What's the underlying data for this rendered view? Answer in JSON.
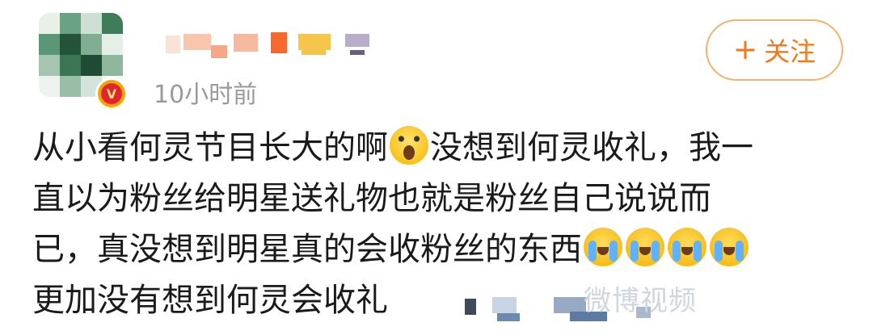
{
  "post": {
    "timestamp": "10小时前",
    "follow_label": "关注",
    "follow_plus": "+",
    "verified_badge": "V",
    "content_lines": [
      [
        "从小看何灵节目长大的啊",
        "😱",
        "没想到何灵收礼，我一"
      ],
      [
        "直以为粉丝给明星送礼物也就是粉丝自己说说而"
      ],
      [
        "已，真没想到明星真的会收粉丝的东西",
        "😭😭😭😭"
      ],
      [
        "更加没有想到何灵会收礼"
      ]
    ],
    "watermark": "微博视频"
  },
  "colors": {
    "follow_text": "#f07a1b",
    "follow_border": "#f1b36c",
    "timestamp": "#9a9a9a",
    "body_text": "#1a1a1a"
  },
  "icons": {
    "avatar": "user-avatar",
    "verified": "verified-v-badge",
    "scream": "face-screaming-emoji",
    "cry": "loudly-crying-face-emoji"
  }
}
